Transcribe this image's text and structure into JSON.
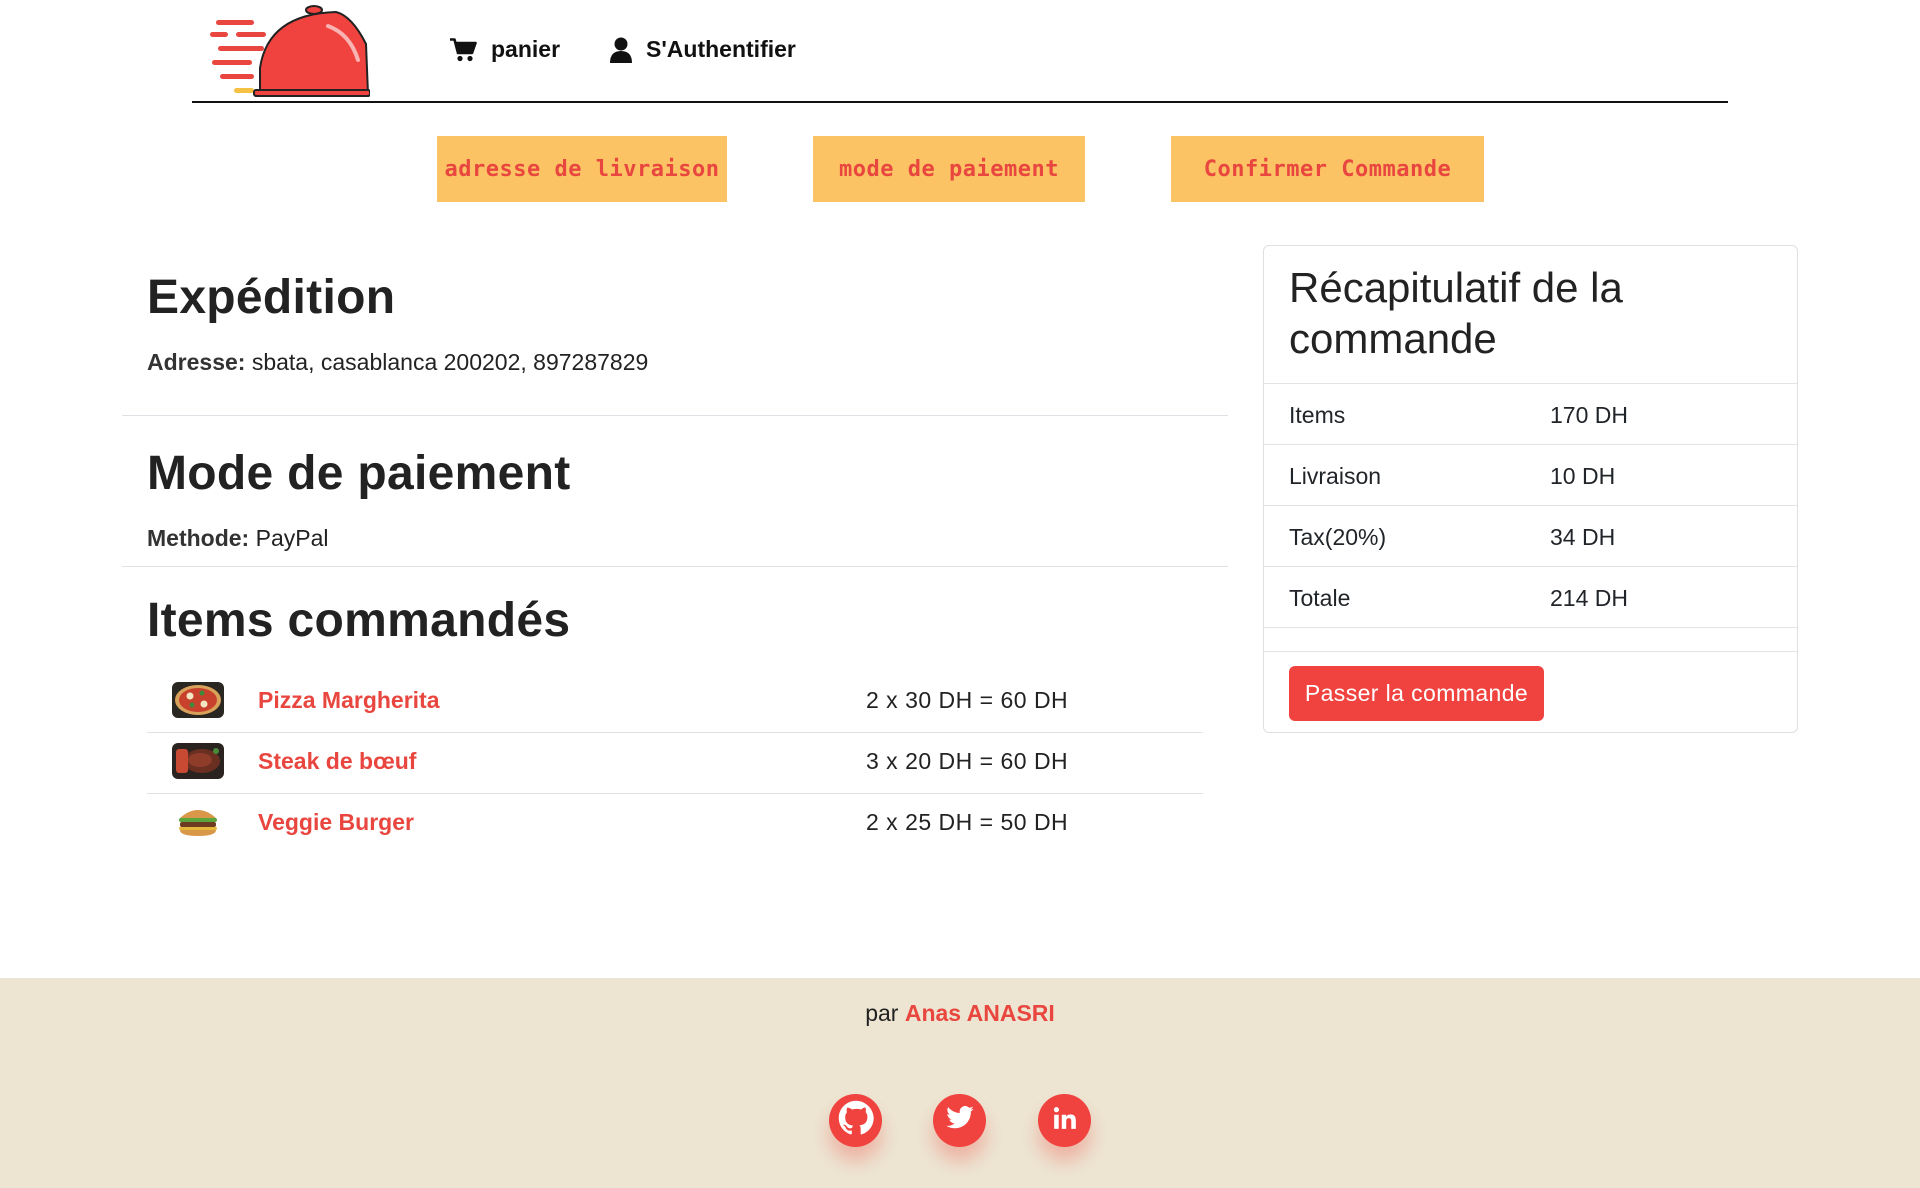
{
  "header": {
    "cart_label": "panier",
    "auth_label": "S'Authentifier"
  },
  "steps": [
    {
      "label": "adresse de livraison"
    },
    {
      "label": "mode de paiement"
    },
    {
      "label": "Confirmer Commande"
    }
  ],
  "shipping": {
    "title": "Expédition",
    "address_label": "Adresse:",
    "address_value": "sbata, casablanca 200202, 897287829"
  },
  "payment": {
    "title": "Mode de paiement",
    "method_label": "Methode:",
    "method_value": "PayPal"
  },
  "items": {
    "title": "Items commandés",
    "list": [
      {
        "name": "Pizza Margherita",
        "price": "2 x 30 DH = 60 DH",
        "image": "pizza-image"
      },
      {
        "name": "Steak de bœuf",
        "price": "3 x 20 DH = 60 DH",
        "image": "steak-image"
      },
      {
        "name": "Veggie Burger",
        "price": "2 x 25 DH = 50 DH",
        "image": "burger-image"
      }
    ]
  },
  "summary": {
    "title": "Récapitulatif de la commande",
    "rows": [
      {
        "label": "Items",
        "value": "170 DH"
      },
      {
        "label": "Livraison",
        "value": "10 DH"
      },
      {
        "label": "Tax(20%)",
        "value": "34 DH"
      },
      {
        "label": "Totale",
        "value": "214 DH"
      }
    ],
    "button_label": "Passer la commande"
  },
  "footer": {
    "prefix": "par",
    "author": "Anas ANASRI",
    "social": [
      "github-icon",
      "twitter-icon",
      "linkedin-icon"
    ]
  },
  "colors": {
    "accent": "#e8463f",
    "step_bg": "#fcc364",
    "footer_bg": "#ede5d2"
  }
}
